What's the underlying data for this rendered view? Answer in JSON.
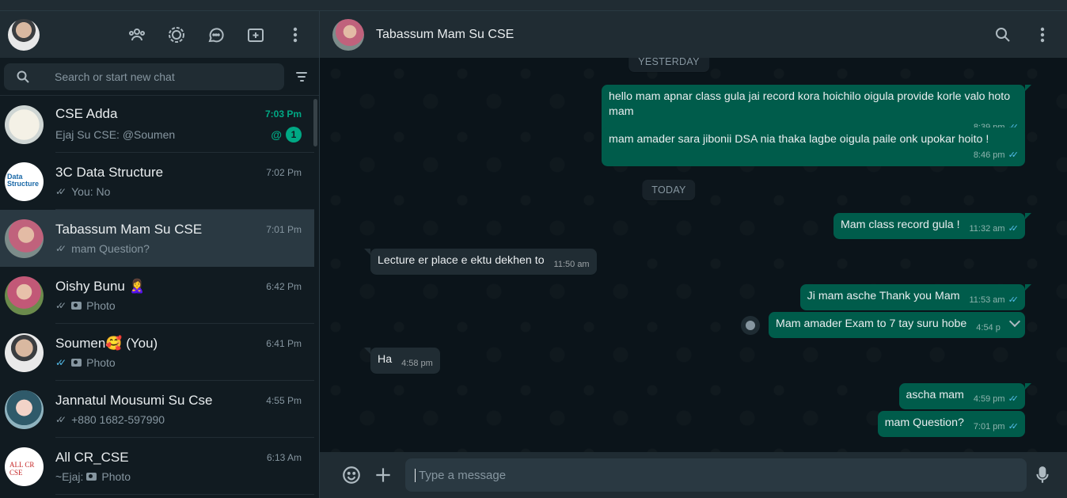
{
  "search": {
    "placeholder": "Search or start new chat"
  },
  "chats": [
    {
      "name": "CSE Adda",
      "time": "7:03 Pm",
      "preview": "Ejaj Su CSE: @Soumen",
      "mention": "@",
      "unread": "1",
      "avatar_color": "#e8ecec"
    },
    {
      "name": "3C Data Structure",
      "time": "7:02 Pm",
      "ticks": "✓✓",
      "preview": "You: No",
      "avatar_color": "#ffffff"
    },
    {
      "name": "Tabassum Mam Su CSE",
      "time": "7:01 Pm",
      "ticks": "✓✓",
      "preview": "mam Question?",
      "avatar_color": "#c48aa0"
    },
    {
      "name": "Oishy Bunu 🙎‍♀️",
      "time": "6:42 Pm",
      "ticks": "✓✓",
      "preview": "Photo",
      "avatar_color": "#b7647a"
    },
    {
      "name": "Soumen🥰 (You)",
      "time": "6:41 Pm",
      "ticks": "✓✓",
      "preview": "Photo",
      "avatar_color": "#cfd3d6"
    },
    {
      "name": "Jannatul Mousumi Su Cse",
      "time": "4:55 Pm",
      "ticks": "✓✓",
      "preview": "+880 1682-597990",
      "avatar_color": "#3f6b7a"
    },
    {
      "name": "All CR_CSE",
      "time": "6:13 Am",
      "preview_prefix": "~Ejaj:",
      "preview": "Photo",
      "avatar_color": "#ffffff"
    }
  ],
  "conversation": {
    "contact_name": "Tabassum Mam Su CSE",
    "date_labels": [
      "YESTERDAY",
      "TODAY"
    ],
    "messages": [
      {
        "dir": "out",
        "text": "hello mam apnar class gula jai record kora hoichilo oigula provide korle valo hoto mam",
        "time": "8:39 pm",
        "ticks": "✓✓"
      },
      {
        "dir": "out",
        "text": "mam amader sara jibonii DSA nia thaka lagbe oigula paile onk upokar hoito !",
        "time": "8:46 pm",
        "ticks": "✓✓"
      },
      {
        "dir": "out",
        "text": "Mam class record gula !",
        "time": "11:32 am",
        "ticks": "✓✓"
      },
      {
        "dir": "in",
        "text": "Lecture er place e ektu dekhen to",
        "time": "11:50 am"
      },
      {
        "dir": "out",
        "text": "Ji mam asche Thank you Mam",
        "time": "11:53 am",
        "ticks": "✓✓"
      },
      {
        "dir": "out",
        "text": "Mam amader Exam to 7 tay suru hobe",
        "time": "4:54 p",
        "ticks": ""
      },
      {
        "dir": "in",
        "text": "Ha",
        "time": "4:58 pm"
      },
      {
        "dir": "out",
        "text": "ascha mam",
        "time": "4:59 pm",
        "ticks": "✓✓"
      },
      {
        "dir": "out",
        "text": "mam Question?",
        "time": "7:01 pm",
        "ticks": "✓✓"
      }
    ]
  },
  "composer": {
    "placeholder": "Type a message"
  },
  "icons": [
    "community-icon",
    "status-icon",
    "channels-icon",
    "new-chat-icon",
    "menu-icon",
    "search-icon",
    "filter-icon",
    "emoji-icon",
    "attach-icon",
    "mic-icon"
  ],
  "colors": {
    "accent": "#00a884",
    "outgoing_bubble": "#005c4b",
    "incoming_bubble": "#202c33",
    "read_ticks": "#53bdeb"
  }
}
